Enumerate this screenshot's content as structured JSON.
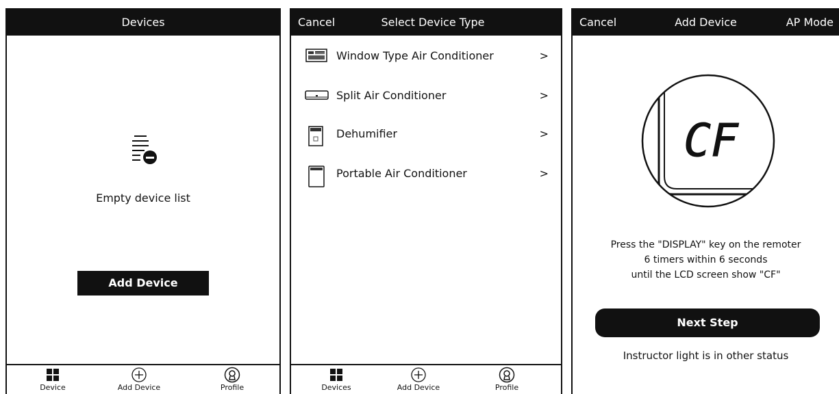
{
  "screen1": {
    "title": "Devices",
    "empty_text": "Empty device list",
    "add_button": "Add Device",
    "tabs": [
      {
        "label": "Device",
        "icon": "grid-icon"
      },
      {
        "label": "Add Device",
        "icon": "plus-circle-icon"
      },
      {
        "label": "Profile",
        "icon": "profile-icon"
      }
    ]
  },
  "screen2": {
    "cancel": "Cancel",
    "title": "Select Device Type",
    "items": [
      {
        "label": "Window Type Air Conditioner",
        "icon": "window-ac-icon"
      },
      {
        "label": "Split Air Conditioner",
        "icon": "split-ac-icon"
      },
      {
        "label": "Dehumifier",
        "icon": "dehumidifier-icon"
      },
      {
        "label": "Portable Air Conditioner",
        "icon": "portable-ac-icon"
      }
    ],
    "chevron": ">",
    "tabs": [
      {
        "label": "Devices",
        "icon": "grid-icon"
      },
      {
        "label": "Add Device",
        "icon": "plus-circle-icon"
      },
      {
        "label": "Profile",
        "icon": "profile-icon"
      }
    ]
  },
  "screen3": {
    "cancel": "Cancel",
    "title": "Add Device",
    "mode": "AP Mode",
    "lcd_text": "CF",
    "instructions": [
      "Press the \"DISPLAY\" key on the remoter",
      "6 timers within 6 seconds",
      "until the LCD screen show \"CF\""
    ],
    "next_button": "Next Step",
    "other_status": "Instructor light is in other status"
  }
}
